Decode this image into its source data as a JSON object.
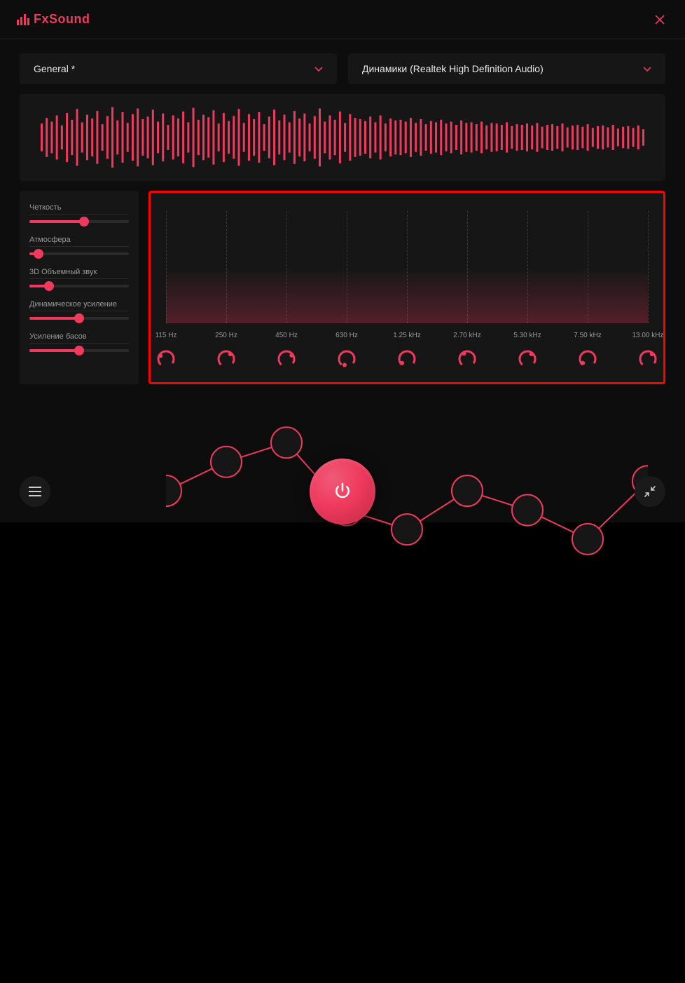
{
  "app": {
    "name": "FxSound"
  },
  "selects": {
    "preset": "General *",
    "output": "Динамики (Realtek High Definition Audio)"
  },
  "sliders": [
    {
      "label": "Четкость",
      "value": 55
    },
    {
      "label": "Атмосфера",
      "value": 9
    },
    {
      "label": "3D Объемный звук",
      "value": 20
    },
    {
      "label": "Динамическое усиление",
      "value": 50
    },
    {
      "label": "Усиление басов",
      "value": 50
    }
  ],
  "eq": {
    "bands": [
      {
        "label": "115 Hz",
        "y": 58,
        "angle": 300
      },
      {
        "label": "250 Hz",
        "y": 52,
        "angle": 40
      },
      {
        "label": "450 Hz",
        "y": 48,
        "angle": 55
      },
      {
        "label": "630 Hz",
        "y": 62,
        "angle": 200
      },
      {
        "label": "1.25 kHz",
        "y": 66,
        "angle": 230
      },
      {
        "label": "2.70 kHz",
        "y": 58,
        "angle": 330
      },
      {
        "label": "5.30 kHz",
        "y": 62,
        "angle": 40
      },
      {
        "label": "7.50 kHz",
        "y": 68,
        "angle": 230
      },
      {
        "label": "13.00 kHz",
        "y": 56,
        "angle": 40
      }
    ]
  },
  "waveform": [
    44,
    62,
    50,
    70,
    38,
    78,
    56,
    90,
    48,
    72,
    60,
    84,
    42,
    68,
    96,
    54,
    80,
    46,
    74,
    92,
    58,
    66,
    88,
    50,
    76,
    40,
    70,
    60,
    82,
    48,
    94,
    56,
    72,
    64,
    86,
    44,
    78,
    52,
    68,
    90,
    46,
    74,
    58,
    80,
    42,
    66,
    88,
    54,
    72,
    48,
    84,
    60,
    76,
    44,
    68,
    92,
    50,
    70,
    56,
    82,
    46,
    74,
    62,
    58,
    52,
    66,
    48,
    70,
    44,
    60,
    54,
    56,
    50,
    62,
    46,
    58,
    42,
    52,
    48,
    56,
    44,
    50,
    40,
    54,
    46,
    48,
    42,
    50,
    38,
    46,
    44,
    40,
    48,
    36,
    42,
    40,
    44,
    38,
    46,
    34,
    40,
    42,
    36,
    44,
    32,
    38,
    40,
    34,
    42,
    30,
    36,
    38,
    32,
    40,
    28,
    34,
    36,
    30,
    38,
    26
  ]
}
